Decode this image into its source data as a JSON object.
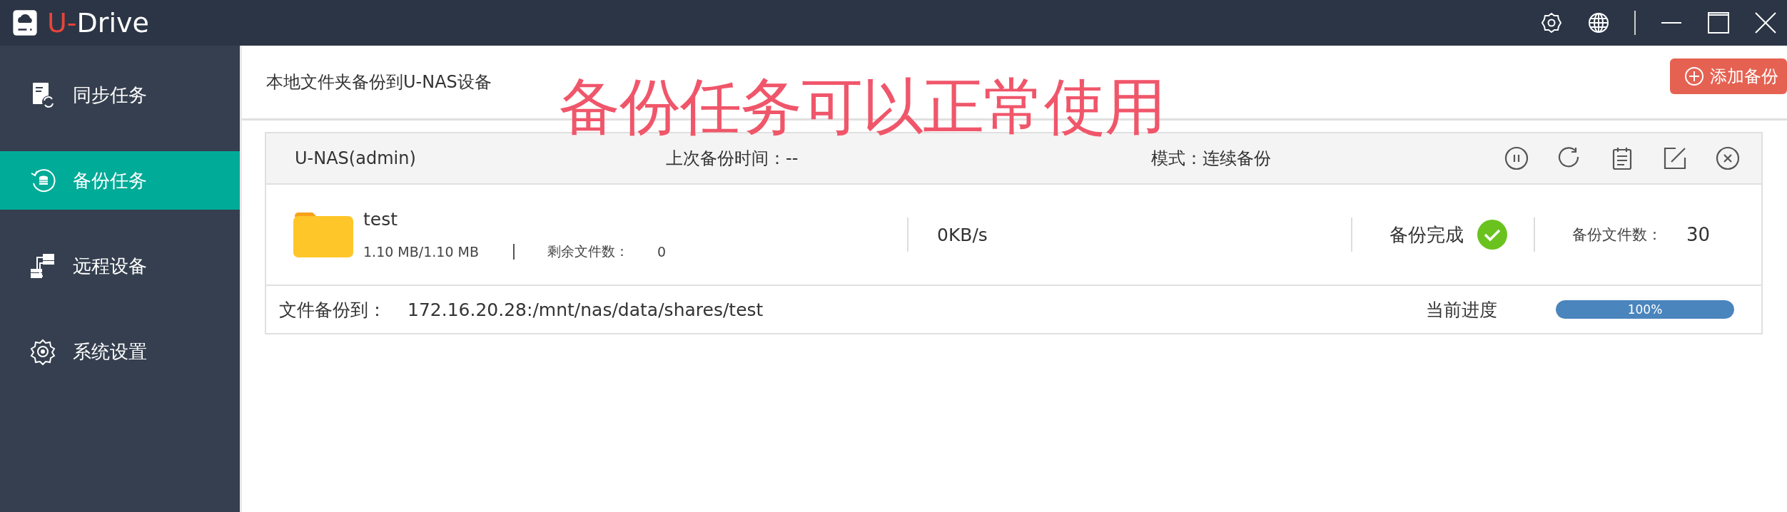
{
  "window": {
    "brand_accent": "U-",
    "brand_name": "Drive"
  },
  "sidebar": {
    "items": [
      {
        "label": "同步任务",
        "selected": false
      },
      {
        "label": "备份任务",
        "selected": true
      },
      {
        "label": "远程设备",
        "selected": false
      },
      {
        "label": "系统设置",
        "selected": false
      }
    ]
  },
  "header": {
    "title": "本地文件夹备份到U-NAS设备",
    "add_button": "添加备份"
  },
  "annotation": "备份任务可以正常使用",
  "task": {
    "device": "U-NAS(admin)",
    "last_backup": "上次备份时间：--",
    "mode": "模式：连续备份",
    "folder": "test",
    "size": "1.10 MB/1.10 MB",
    "remaining_label": "剩余文件数：",
    "remaining": "0",
    "speed": "0KB/s",
    "status": "备份完成",
    "completed": true,
    "file_count_label": "备份文件数：",
    "file_count": "30",
    "destination_label": "文件备份到：",
    "destination": "172.16.20.28:/mnt/nas/data/shares/test",
    "progress_label": "当前进度",
    "progress": {
      "level": 1,
      "reading": "100%"
    }
  }
}
